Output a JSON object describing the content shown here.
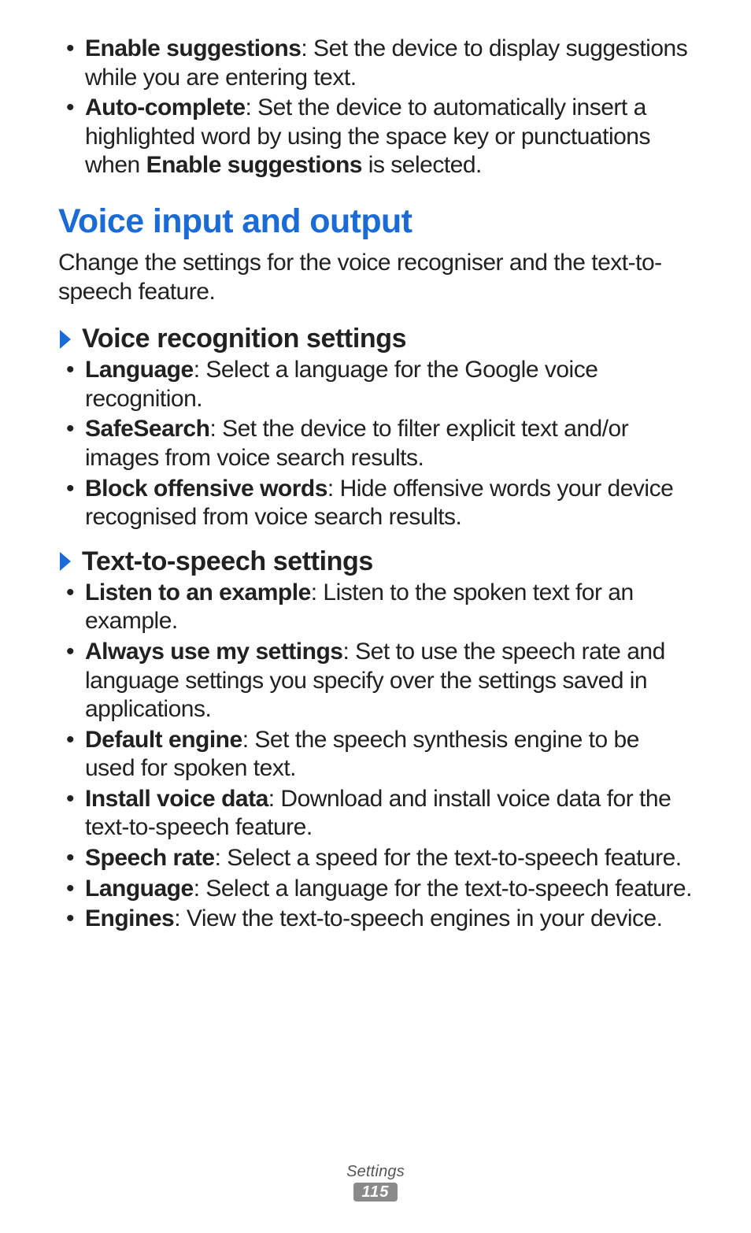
{
  "top_items": [
    {
      "term": "Enable suggestions",
      "desc": ": Set the device to display suggestions while you are entering text."
    },
    {
      "term": "Auto-complete",
      "desc_pre": ": Set the device to automatically insert a highlighted word by using the space key or punctuations when ",
      "inline_bold": "Enable suggestions",
      "desc_post": " is selected."
    }
  ],
  "section": {
    "title": "Voice input and output",
    "lead": "Change the settings for the voice recogniser and the text-to-speech feature."
  },
  "voice_recognition": {
    "heading": "Voice recognition settings",
    "items": [
      {
        "term": "Language",
        "desc": ": Select a language for the Google voice recognition."
      },
      {
        "term": "SafeSearch",
        "desc": ": Set the device to filter explicit text and/or images from voice search results."
      },
      {
        "term": "Block offensive words",
        "desc": ": Hide offensive words your device recognised from voice search results."
      }
    ]
  },
  "tts": {
    "heading": "Text-to-speech settings",
    "items": [
      {
        "term": "Listen to an example",
        "desc": ": Listen to the spoken text for an example."
      },
      {
        "term": "Always use my settings",
        "desc": ": Set to use the speech rate and language settings you specify over the settings saved in applications."
      },
      {
        "term": "Default engine",
        "desc": ": Set the speech synthesis engine to be used for spoken text."
      },
      {
        "term": "Install voice data",
        "desc": ": Download and install voice data for the text-to-speech feature."
      },
      {
        "term": "Speech rate",
        "desc": ": Select a speed for the text-to-speech feature."
      },
      {
        "term": "Language",
        "desc": ": Select a language for the text-to-speech feature."
      },
      {
        "term": "Engines",
        "desc": ": View the text-to-speech engines in your device."
      }
    ]
  },
  "footer": {
    "section": "Settings",
    "page": "115"
  },
  "colors": {
    "heading_blue": "#1b6bd6",
    "chevron_blue": "#1b6bd6",
    "badge_bg": "#8a8a8a"
  }
}
